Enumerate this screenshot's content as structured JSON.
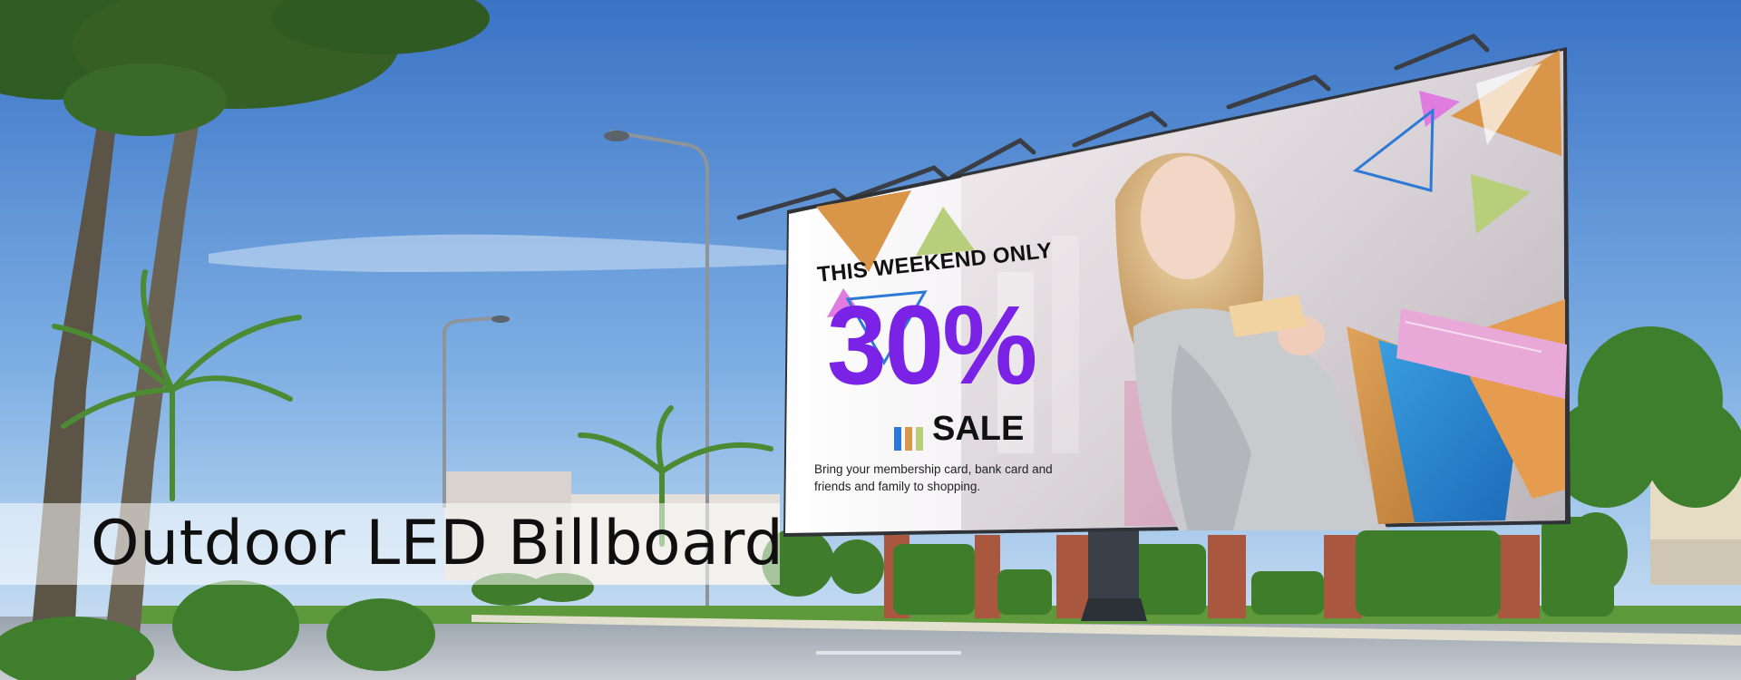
{
  "caption": {
    "title": "Outdoor LED Billboard"
  },
  "billboard": {
    "headline": "THIS WEEKEND ONLY",
    "discount": "30%",
    "sale_label": "SALE",
    "body_text": "Bring your membership card, bank card and friends and family to shopping."
  },
  "colors": {
    "sky_top": "#3f78c8",
    "sky_bottom": "#cfe2f4",
    "discount_purple": "#7a22e6",
    "accent_orange": "#d99548",
    "accent_green": "#b7cf7a",
    "accent_pink": "#e07be0",
    "accent_blue": "#2d7ad6"
  }
}
